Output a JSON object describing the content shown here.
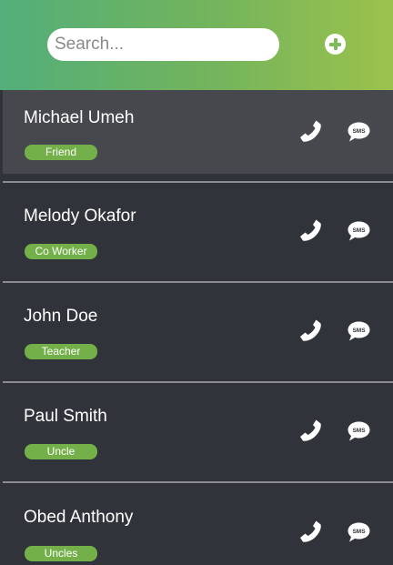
{
  "search": {
    "placeholder": "Search..."
  },
  "header": {
    "add_icon": "plus-circle-icon"
  },
  "contacts": [
    {
      "name": "Michael Umeh",
      "tag": "Friend"
    },
    {
      "name": "Melody Okafor",
      "tag": "Co Worker"
    },
    {
      "name": "John Doe",
      "tag": "Teacher"
    },
    {
      "name": "Paul Smith",
      "tag": "Uncle"
    },
    {
      "name": "Obed Anthony",
      "tag": "Uncles"
    }
  ],
  "icons": {
    "call": "phone-icon",
    "sms": "sms-bubble-icon"
  },
  "colors": {
    "header_gradient_start": "#52ae7a",
    "header_gradient_end": "#9bc24c",
    "tag_green": "#74b04a",
    "list_background": "#31333a",
    "active_row": "#46484d"
  }
}
